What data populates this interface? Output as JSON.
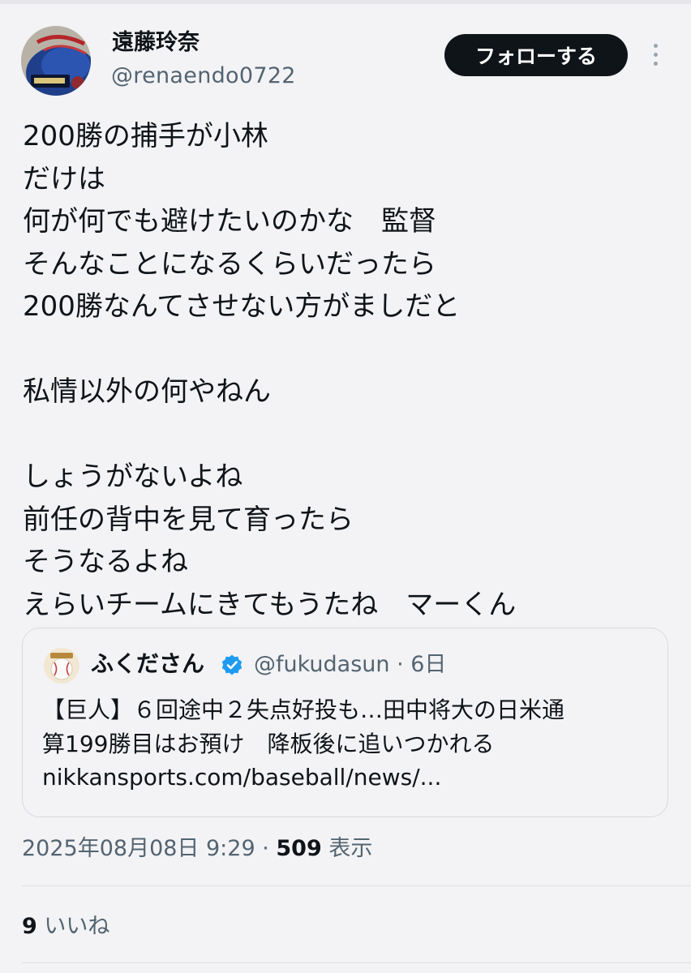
{
  "author": {
    "display_name": "遠藤玲奈",
    "handle": "@renaendo0722",
    "avatar_icon": "baseball-glove-avatar"
  },
  "follow_button_label": "フォローする",
  "more_icon": "more-vertical-icon",
  "post_lines": [
    "200勝の捕手が小林",
    "だけは",
    "何が何でも避けたいのかな　監督",
    "そんなことになるくらいだったら",
    "200勝なんてさせない方がましだと",
    "",
    "私情以外の何やねん",
    "",
    "しょうがないよね",
    "前任の背中を見て育ったら",
    "そうなるよね",
    "えらいチームにきてもうたね　マーくん"
  ],
  "quote": {
    "name": "ふくださん",
    "verified": true,
    "handle_and_time": "@fukudasun · 6日",
    "lines": [
      "【巨人】６回途中２失点好投も…田中将大の日米通",
      "算199勝目はお預け　降板後に追いつかれる",
      "nikkansports.com/baseball/news/..."
    ]
  },
  "meta": {
    "timestamp": "2025年08月08日 9:29",
    "separator": " · ",
    "views": "509",
    "views_label": " 表示"
  },
  "likes": {
    "count": "9",
    "label": " いいね"
  },
  "colors": {
    "background": "#f3f3f5",
    "text": "#0f1419",
    "secondary": "#536471",
    "follow_button": "#0f1419",
    "verified": "#1d9bf0"
  }
}
